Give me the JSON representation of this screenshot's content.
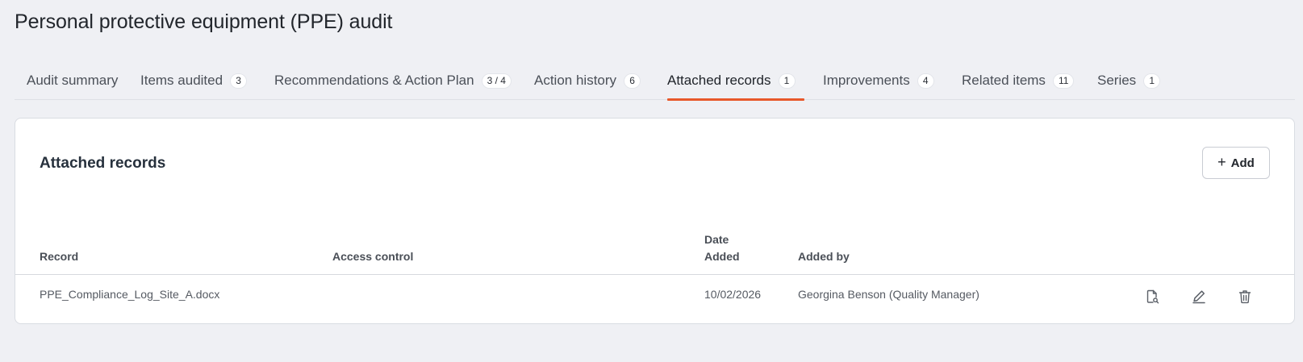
{
  "page": {
    "title": "Personal protective equipment (PPE) audit"
  },
  "tabs": [
    {
      "label": "Audit summary",
      "badge": ""
    },
    {
      "label": "Items audited",
      "badge": "3"
    },
    {
      "label": "Recommendations & Action Plan",
      "badge": "3 / 4"
    },
    {
      "label": "Action history",
      "badge": "6"
    },
    {
      "label": "Attached records",
      "badge": "1",
      "active": true
    },
    {
      "label": "Improvements",
      "badge": "4"
    },
    {
      "label": "Related items",
      "badge": "11"
    },
    {
      "label": "Series",
      "badge": "1"
    }
  ],
  "card": {
    "title": "Attached records",
    "add_label": "Add"
  },
  "table": {
    "headers": {
      "record": "Record",
      "access": "Access control",
      "date_line1": "Date",
      "date_line2": "Added",
      "added_by": "Added by"
    },
    "rows": [
      {
        "record": "PPE_Compliance_Log_Site_A.docx",
        "access": "",
        "date": "10/02/2026",
        "added_by": "Georgina Benson (Quality Manager)"
      }
    ]
  },
  "icons": {
    "view": "view-document-icon",
    "edit": "edit-pencil-icon",
    "delete": "trash-icon",
    "add": "plus-icon"
  },
  "colors": {
    "accent": "#e8582a",
    "background": "#eff0f4"
  }
}
